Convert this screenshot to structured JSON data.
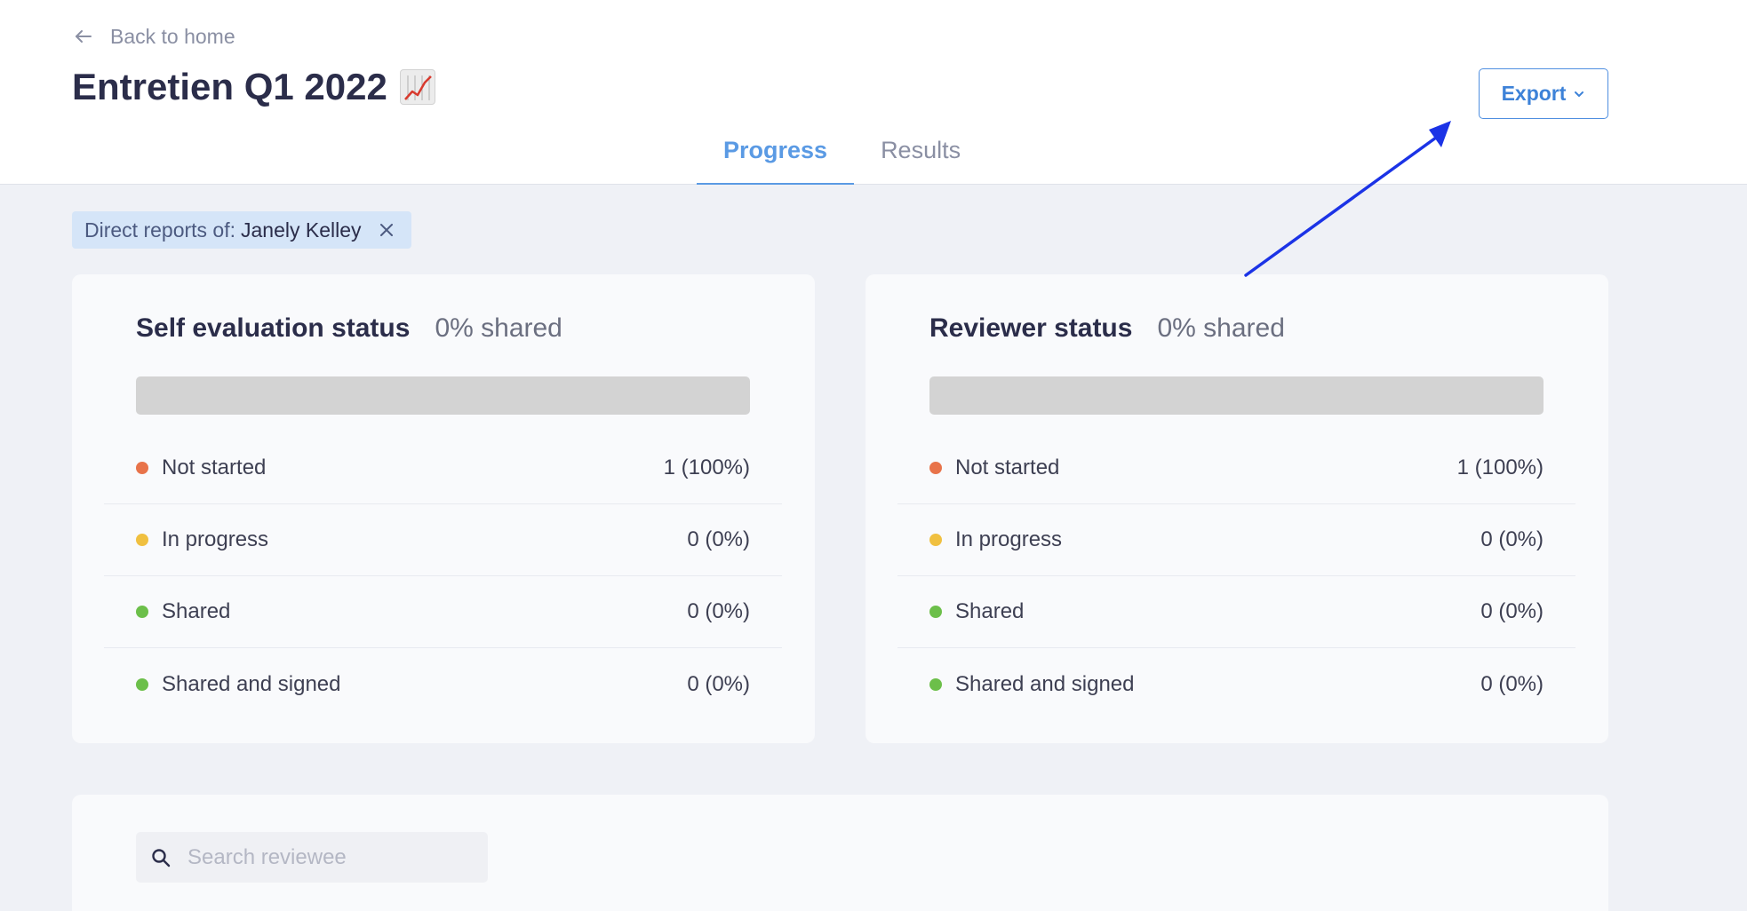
{
  "header": {
    "back_label": "Back to home",
    "title": "Entretien Q1 2022",
    "export_label": "Export",
    "tabs": [
      {
        "label": "Progress",
        "active": true
      },
      {
        "label": "Results",
        "active": false
      }
    ]
  },
  "filter": {
    "prefix": "Direct reports of:",
    "value": "Janely Kelley"
  },
  "self_evaluation": {
    "title": "Self evaluation status",
    "shared_pct": "0% shared",
    "progress": 0,
    "statuses": [
      {
        "label": "Not started",
        "count": "1 (100%)",
        "color": "#e8734a"
      },
      {
        "label": "In progress",
        "count": "0 (0%)",
        "color": "#f0c040"
      },
      {
        "label": "Shared",
        "count": "0 (0%)",
        "color": "#6cbf4a"
      },
      {
        "label": "Shared and signed",
        "count": "0 (0%)",
        "color": "#6cbf4a"
      }
    ]
  },
  "reviewer": {
    "title": "Reviewer status",
    "shared_pct": "0% shared",
    "progress": 0,
    "statuses": [
      {
        "label": "Not started",
        "count": "1 (100%)",
        "color": "#e8734a"
      },
      {
        "label": "In progress",
        "count": "0 (0%)",
        "color": "#f0c040"
      },
      {
        "label": "Shared",
        "count": "0 (0%)",
        "color": "#6cbf4a"
      },
      {
        "label": "Shared and signed",
        "count": "0 (0%)",
        "color": "#6cbf4a"
      }
    ]
  },
  "search": {
    "placeholder": "Search reviewee",
    "value": ""
  },
  "colors": {
    "accent": "#5a9ae4",
    "annotation_arrow": "#1b33e6"
  }
}
